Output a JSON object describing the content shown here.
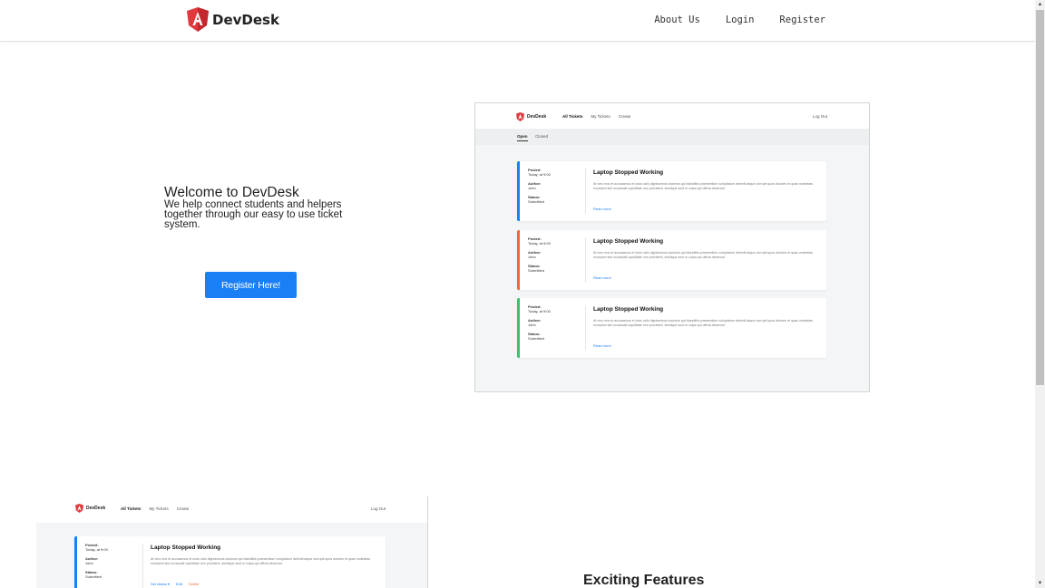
{
  "brand": {
    "name": "DevDesk"
  },
  "nav": {
    "about": "About Us",
    "login": "Login",
    "register": "Register"
  },
  "hero": {
    "title": "Welcome to DevDesk",
    "subtitle": "We help connect students and helpers together through our easy to use ticket system.",
    "cta": "Register Here!"
  },
  "mockup": {
    "brand": "DevDesk",
    "links": [
      "All Tickets",
      "My Tickets",
      "Create"
    ],
    "logout": "Log Out",
    "tabs": [
      "Open",
      "Closed"
    ],
    "tickets": [
      {
        "posted_label": "Posted:",
        "posted": "Today, at 9:00",
        "author_label": "Author:",
        "author": "John",
        "status_label": "Status:",
        "status": "Submitted",
        "title": "Laptop Stopped Working",
        "body": "At vero eos et accusamus et iusto odio dignissimos ducimus qui blanditiis praesentium voluptatum deleniti atque corrupti quos dolores et quas molestias excepturi sint occaecati cupiditate non provident, similique sunt in culpa qui officia deserunt.",
        "more": "Read more",
        "accent": "#1a7ff5"
      },
      {
        "posted_label": "Posted:",
        "posted": "Today, at 9:00",
        "author_label": "Author:",
        "author": "John",
        "status_label": "Status:",
        "status": "Submitted",
        "title": "Laptop Stopped Working",
        "body": "At vero eos et accusamus et iusto odio dignissimos ducimus qui blanditiis praesentium voluptatum deleniti atque corrupti quos dolores et quas molestias excepturi sint occaecati cupiditate non provident, similique sunt in culpa qui officia deserunt.",
        "more": "Read more",
        "accent": "#f06a35"
      },
      {
        "posted_label": "Posted:",
        "posted": "Today, at 9:00",
        "author_label": "Author:",
        "author": "John",
        "status_label": "Status:",
        "status": "Submitted",
        "title": "Laptop Stopped Working",
        "body": "At vero eos et accusamus et iusto odio dignissimos ducimus qui blanditiis praesentium voluptatum deleniti atque corrupti quos dolores et quas molestias excepturi sint occaecati cupiditate non provident, similique sunt in culpa qui officia deserunt.",
        "more": "Read more",
        "accent": "#3ec06b"
      }
    ]
  },
  "mockup2": {
    "brand": "DevDesk",
    "links": [
      "All Tickets",
      "My Tickets",
      "Create"
    ],
    "logout": "Log Out",
    "ticket": {
      "posted_label": "Posted:",
      "posted": "Today, at 9:00",
      "author_label": "Author:",
      "author": "John",
      "status_label": "Status:",
      "status": "Submitted",
      "title": "Laptop Stopped Working",
      "body": "At vero eos et accusamus et iusto odio dignissimos ducimus qui blanditiis praesentium voluptatum deleniti atque corrupti quos dolores et quas molestias excepturi sint occaecati cupiditate non provident, similique sunt in culpa qui officia deserunt.",
      "actions": [
        "Set status ▾",
        "Edit",
        "Delete"
      ],
      "accent": "#1a7ff5"
    }
  },
  "features": {
    "title": "Exciting Features"
  },
  "colors": {
    "primary": "#1a7ff5",
    "logo": "#e03a3e"
  }
}
